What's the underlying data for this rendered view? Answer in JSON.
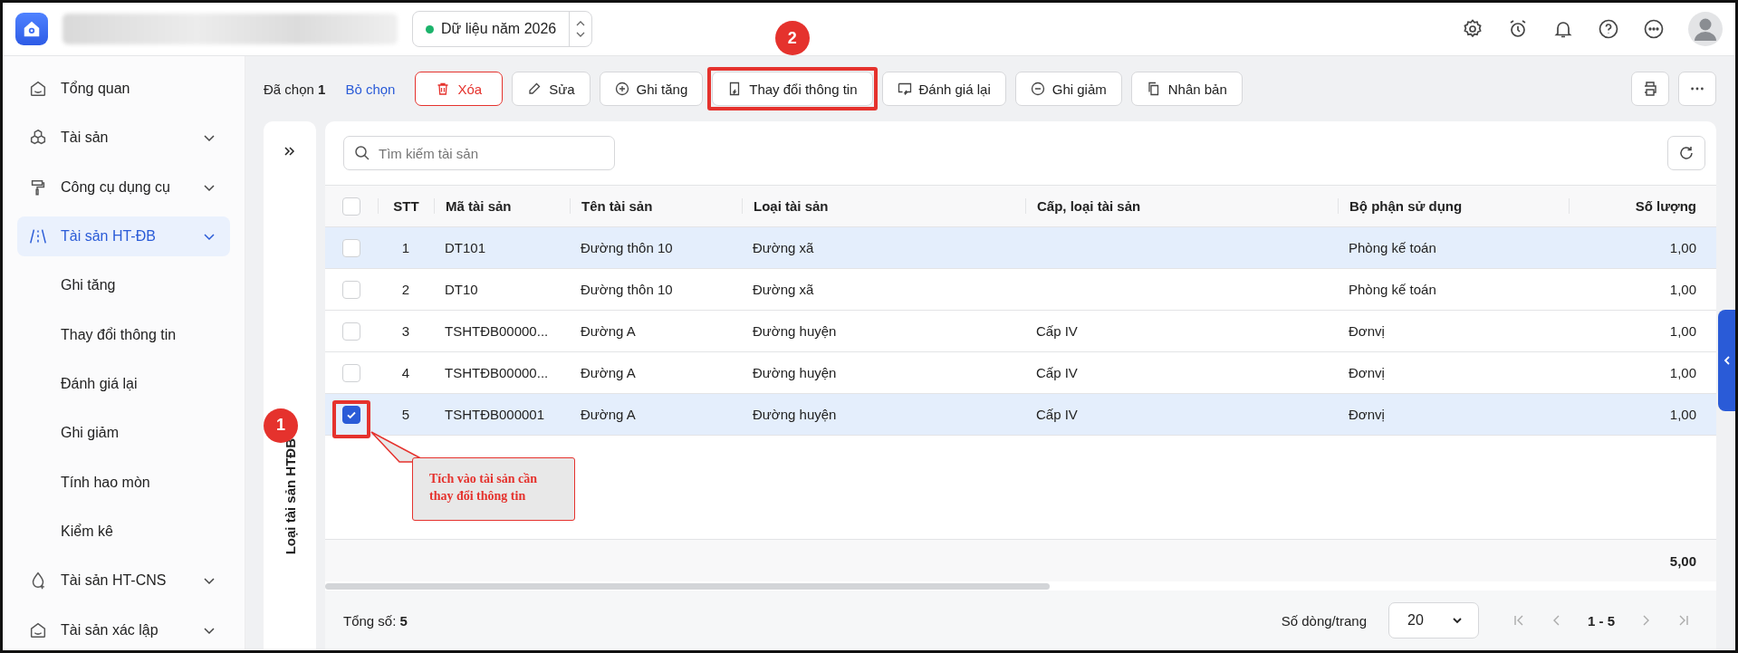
{
  "top_bar": {
    "year_selector": {
      "label": "Dữ liệu năm 2026"
    }
  },
  "sidebar": {
    "items": [
      {
        "label": "Tổng quan",
        "kind": "link",
        "selected": false
      },
      {
        "label": "Tài sản",
        "kind": "group",
        "selected": false
      },
      {
        "label": "Công cụ dụng cụ",
        "kind": "group",
        "selected": false
      },
      {
        "label": "Tài sản HT-ĐB",
        "kind": "group",
        "selected": true,
        "children": [
          {
            "label": "Ghi tăng",
            "selected": false
          },
          {
            "label": "Thay đổi thông tin",
            "selected": false
          },
          {
            "label": "Đánh giá lại",
            "selected": false
          },
          {
            "label": "Ghi giảm",
            "selected": false
          },
          {
            "label": "Tính hao mòn",
            "selected": false
          },
          {
            "label": "Kiểm kê",
            "selected": false
          }
        ]
      },
      {
        "label": "Tài sản HT-CNS",
        "kind": "group",
        "selected": false
      },
      {
        "label": "Tài sản xác lập",
        "kind": "group",
        "selected": false
      }
    ]
  },
  "toolbar": {
    "selection": "Đã chọn **1**",
    "clear_link": "Bỏ chọn",
    "buttons": [
      {
        "label": "Xóa",
        "kind": "danger"
      },
      {
        "label": "Sửa",
        "kind": "normal"
      },
      {
        "label": "Ghi tăng",
        "kind": "normal"
      },
      {
        "label": "Thay đổi thông tin",
        "kind": "normal",
        "step": "2"
      },
      {
        "label": "Đánh giá lại",
        "kind": "normal"
      },
      {
        "label": "Ghi giảm",
        "kind": "normal"
      },
      {
        "label": "Nhân bản",
        "kind": "normal"
      }
    ]
  },
  "side_panel": {
    "label": "Loại tài sản HTĐB"
  },
  "search": {
    "placeholder": "Tìm kiếm tài sản"
  },
  "table": {
    "header_checked": false,
    "columns": [
      "STT",
      "Mã tài sản",
      "Tên tài sản",
      "Loại tài sản",
      "Cấp, loại tài sản",
      "Bộ phận sử dụng",
      "Số lượng"
    ],
    "rows": [
      {
        "checked": false,
        "highlighted": true,
        "cells": [
          "1",
          "DT101",
          "Đường thôn 10",
          "Đường xã",
          "",
          "Phòng kế toán",
          "1,00"
        ]
      },
      {
        "checked": false,
        "highlighted": false,
        "cells": [
          "2",
          "DT10",
          "Đường thôn 10",
          "Đường xã",
          "",
          "Phòng kế toán",
          "1,00"
        ]
      },
      {
        "checked": false,
        "highlighted": false,
        "cells": [
          "3",
          "TSHTĐB00000...",
          "Đường A",
          "Đường huyện",
          "Cấp IV",
          "Đơnvị",
          "1,00"
        ]
      },
      {
        "checked": false,
        "highlighted": false,
        "cells": [
          "4",
          "TSHTĐB00000...",
          "Đường A",
          "Đường huyện",
          "Cấp IV",
          "Đơnvị",
          "1,00"
        ]
      },
      {
        "checked": true,
        "highlighted": true,
        "step": "1",
        "callout": "Tích vào tài sản cần thay đổi thông tin",
        "cells": [
          "5",
          "TSHTĐB000001",
          "Đường A",
          "Đường huyện",
          "Cấp IV",
          "Đơnvị",
          "1,00"
        ]
      }
    ],
    "total": "5,00"
  },
  "footer": {
    "total_label": "Tổng số:",
    "total_value": "5",
    "page_size_label": "Số dòng/trang",
    "page_size": "20",
    "range": "1 - 5"
  }
}
